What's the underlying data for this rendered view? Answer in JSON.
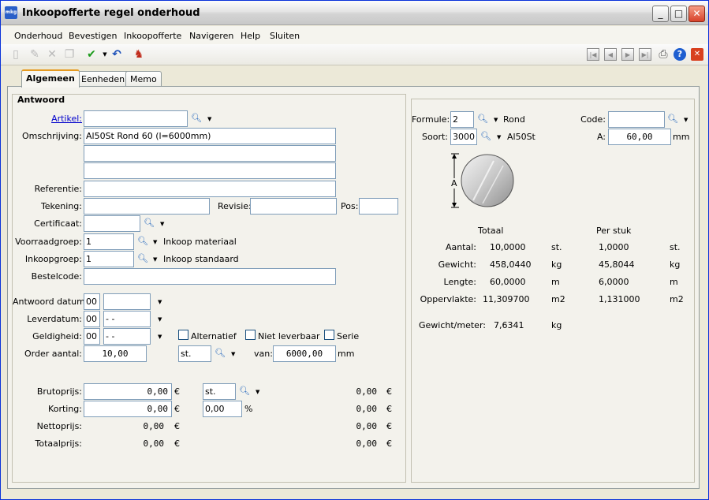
{
  "window": {
    "title": "Inkoopofferte regel onderhoud",
    "app_icon_text": "mkg",
    "buttons": {
      "minimize": "_",
      "maximize": "□",
      "close": "✕"
    }
  },
  "menu": [
    "Onderhoud",
    "Bevestigen",
    "Inkoopofferte",
    "Navigeren",
    "Help",
    "Sluiten"
  ],
  "toolbar": {
    "icons": [
      "new-document-icon",
      "edit-icon",
      "delete-icon",
      "copy-icon",
      "confirm-check-icon",
      "dropdown-arrow-icon",
      "undo-icon",
      "user-lookup-icon",
      "first-record-icon",
      "previous-record-icon",
      "next-record-icon",
      "last-record-icon",
      "print-icon",
      "help-icon",
      "close-red-icon"
    ]
  },
  "tabs": [
    "Algemeen",
    "Eenheden",
    "Memo"
  ],
  "antwoord": {
    "group_title": "Antwoord",
    "labels": {
      "artikel": "Artikel:",
      "omschrijving": "Omschrijving:",
      "referentie": "Referentie:",
      "tekening": "Tekening:",
      "revisie": "Revisie:",
      "pos": "Pos:",
      "certificaat": "Certificaat:",
      "voorraadgroep": "Voorraadgroep:",
      "inkoopgroep": "Inkoopgroep:",
      "bestelcode": "Bestelcode:",
      "antwoord_datum": "Antwoord datum:",
      "leverdatum": "Leverdatum:",
      "geldigheid": "Geldigheid:",
      "order_aantal": "Order aantal:",
      "van": "van:",
      "mm": "mm",
      "brutoprijs": "Brutoprijs:",
      "korting": "Korting:",
      "nettoprijs": "Nettoprijs:",
      "totaalprijs": "Totaalprijs:",
      "currency": "€",
      "percent": "%"
    },
    "values": {
      "artikel": "",
      "omschrijving1": "Al50St Rond 60 (l=6000mm)",
      "omschrijving2": "",
      "omschrijving3": "",
      "referentie": "",
      "tekening": "",
      "revisie": "",
      "pos": "",
      "certificaat": "",
      "voorraadgroep": "1",
      "voorraadgroep_desc": "Inkoop materiaal",
      "inkoopgroep": "1",
      "inkoopgroep_desc": "Inkoop standaard",
      "bestelcode": "",
      "antwoord_datum_code": "00",
      "antwoord_datum": "",
      "leverdatum_code": "00",
      "leverdatum": "- -",
      "geldigheid_code": "00",
      "geldigheid": "- -",
      "order_aantal": "10,00",
      "order_unit": "st.",
      "van": "6000,00",
      "brutoprijs": "0,00",
      "bruto_unit": "st.",
      "bruto_total": "0,00",
      "korting": "0,00",
      "korting_pct": "0,00",
      "korting_total": "0,00",
      "nettoprijs": "0,00",
      "netto_total": "0,00",
      "totaalprijs": "0,00",
      "totaal_total": "0,00"
    },
    "checkboxes": {
      "alternatief": "Alternatief",
      "niet_leverbaar": "Niet leverbaar",
      "serie": "Serie"
    }
  },
  "profile": {
    "labels": {
      "formule": "Formule:",
      "soort": "Soort:",
      "code": "Code:",
      "a": "A:",
      "mm": "mm",
      "dim_a": "A"
    },
    "formule": "2",
    "formule_desc": "Rond",
    "soort": "3000",
    "soort_desc": "Al50St",
    "code": "",
    "a_value": "60,00",
    "table": {
      "headers": {
        "totaal": "Totaal",
        "per_stuk": "Per stuk"
      },
      "rows": [
        {
          "label": "Aantal:",
          "totaal": "10,0000",
          "unit": "st.",
          "per_stuk": "1,0000",
          "unit2": "st."
        },
        {
          "label": "Gewicht:",
          "totaal": "458,0440",
          "unit": "kg",
          "per_stuk": "45,8044",
          "unit2": "kg"
        },
        {
          "label": "Lengte:",
          "totaal": "60,0000",
          "unit": "m",
          "per_stuk": "6,0000",
          "unit2": "m"
        },
        {
          "label": "Oppervlakte:",
          "totaal": "11,309700",
          "unit": "m2",
          "per_stuk": "1,131000",
          "unit2": "m2"
        }
      ],
      "gewicht_meter": {
        "label": "Gewicht/meter:",
        "value": "7,6341",
        "unit": "kg"
      }
    }
  }
}
